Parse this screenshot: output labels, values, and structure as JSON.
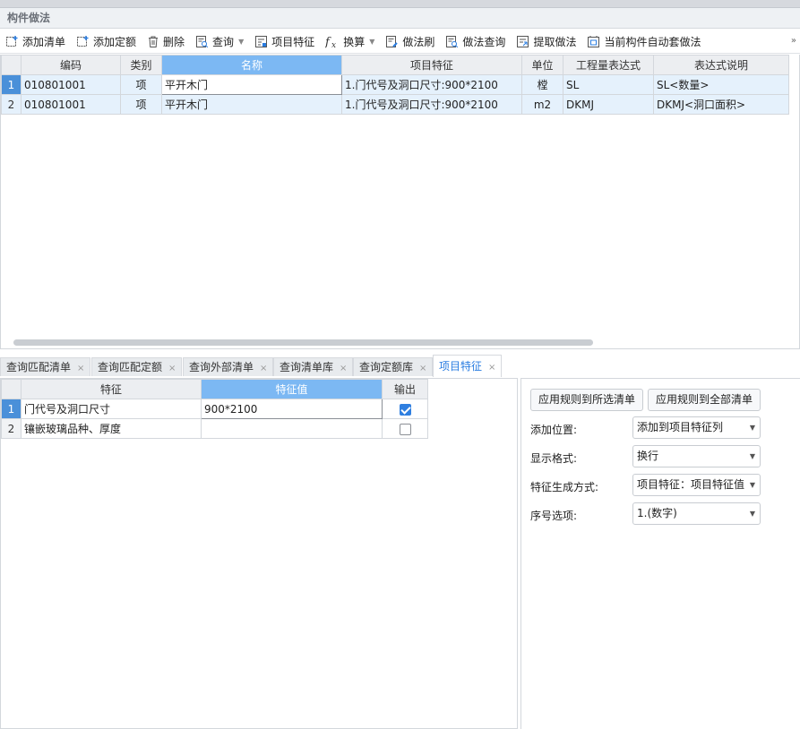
{
  "panel_title": "构件做法",
  "toolbar": {
    "add_list": "添加清单",
    "add_quota": "添加定额",
    "delete": "删除",
    "query": "查询",
    "item_feature": "项目特征",
    "convert": "换算",
    "method_brush": "做法刷",
    "method_query": "做法查询",
    "extract_method": "提取做法",
    "auto_apply": "当前构件自动套做法",
    "more": "»"
  },
  "upper_table": {
    "headers": [
      "编码",
      "类别",
      "名称",
      "项目特征",
      "单位",
      "工程量表达式",
      "表达式说明"
    ],
    "rows": [
      {
        "num": "1",
        "code": "010801001",
        "type": "项",
        "name": "平开木门",
        "feature": "1.门代号及洞口尺寸:900*2100",
        "unit": "樘",
        "expr": "SL",
        "expr_desc": "SL<数量>"
      },
      {
        "num": "2",
        "code": "010801001",
        "type": "项",
        "name": "平开木门",
        "feature": "1.门代号及洞口尺寸:900*2100",
        "unit": "m2",
        "expr": "DKMJ",
        "expr_desc": "DKMJ<洞口面积>"
      }
    ]
  },
  "tabs": [
    {
      "label": "查询匹配清单",
      "close": "×"
    },
    {
      "label": "查询匹配定额",
      "close": "×"
    },
    {
      "label": "查询外部清单",
      "close": "×"
    },
    {
      "label": "查询清单库",
      "close": "×"
    },
    {
      "label": "查询定额库",
      "close": "×"
    },
    {
      "label": "项目特征",
      "close": "×"
    }
  ],
  "feature_table": {
    "headers": [
      "特征",
      "特征值",
      "输出"
    ],
    "rows": [
      {
        "num": "1",
        "feature": "门代号及洞口尺寸",
        "value": "900*2100",
        "output": true
      },
      {
        "num": "2",
        "feature": "镶嵌玻璃品种、厚度",
        "value": "",
        "output": false
      }
    ]
  },
  "right_panel": {
    "apply_selected": "应用规则到所选清单",
    "apply_all": "应用规则到全部清单",
    "add_position_label": "添加位置:",
    "add_position_value": "添加到项目特征列",
    "display_format_label": "显示格式:",
    "display_format_value": "换行",
    "gen_method_label": "特征生成方式:",
    "gen_method_value": "项目特征：项目特征值",
    "serial_label": "序号选项:",
    "serial_value": "1.(数字)"
  },
  "colors": {
    "accent": "#2a7de1",
    "header_active": "#7cb8f3",
    "row_highlight": "#e5f1fc"
  }
}
